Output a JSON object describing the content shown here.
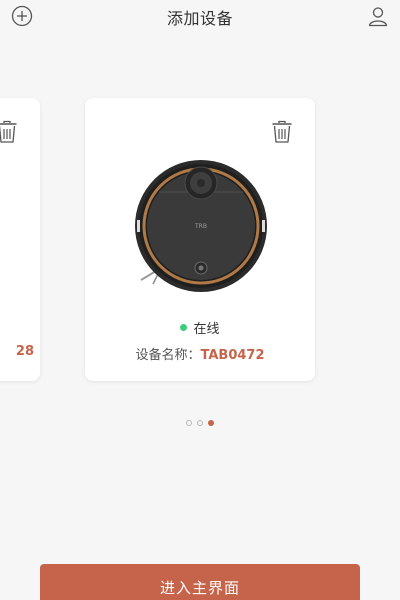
{
  "colors": {
    "accent": "#c5644a",
    "online": "#3ccf7a",
    "icon": "#555555"
  },
  "header": {
    "title": "添加设备",
    "left_icon": "plus-circle-icon",
    "right_icon": "user-icon"
  },
  "devices": [
    {
      "name_partial": "28"
    },
    {
      "status": "在线",
      "name_label": "设备名称：",
      "name_value": "TAB0472",
      "brand_text": "TRB"
    }
  ],
  "pager": {
    "count": 3,
    "active_index": 2
  },
  "enter_button": {
    "label": "进入主界面"
  }
}
